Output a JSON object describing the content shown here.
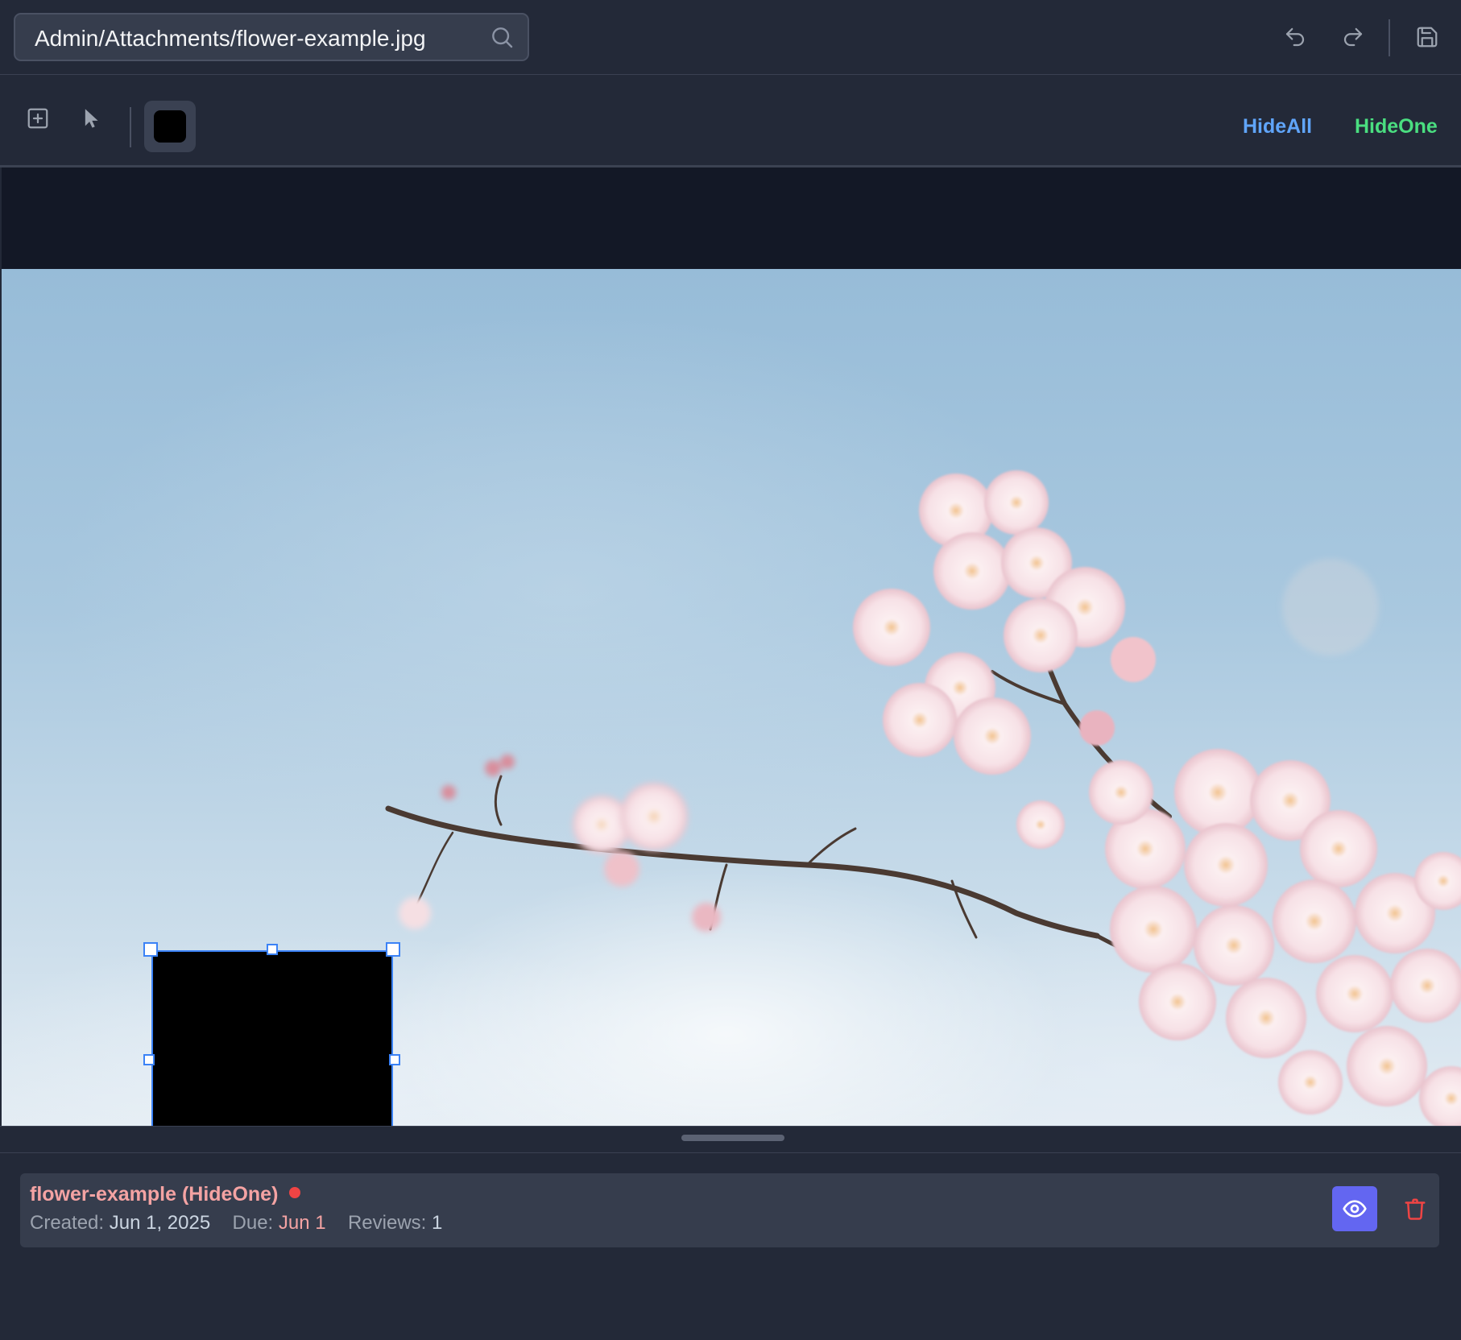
{
  "header": {
    "path": "Admin/Attachments/flower-example.jpg"
  },
  "toolbar": {
    "hide_all_label": "HideAll",
    "hide_one_label": "HideOne",
    "current_color": "#000000"
  },
  "colors": {
    "hide_all": "#60a5fa",
    "hide_one": "#4ade80",
    "accent": "#6366f1",
    "danger": "#ef4444"
  },
  "icons": {
    "search": "search-icon",
    "undo": "undo-icon",
    "redo": "redo-icon",
    "save": "save-icon",
    "add": "plus-square-icon",
    "select": "cursor-arrow-icon",
    "view": "eye-icon",
    "delete": "trash-icon"
  },
  "cards": [
    {
      "title": "flower-example (HideOne)",
      "created_label": "Created:",
      "created_value": "Jun 1, 2025",
      "due_label": "Due:",
      "due_value": "Jun 1",
      "reviews_label": "Reviews:",
      "reviews_value": "1"
    }
  ]
}
